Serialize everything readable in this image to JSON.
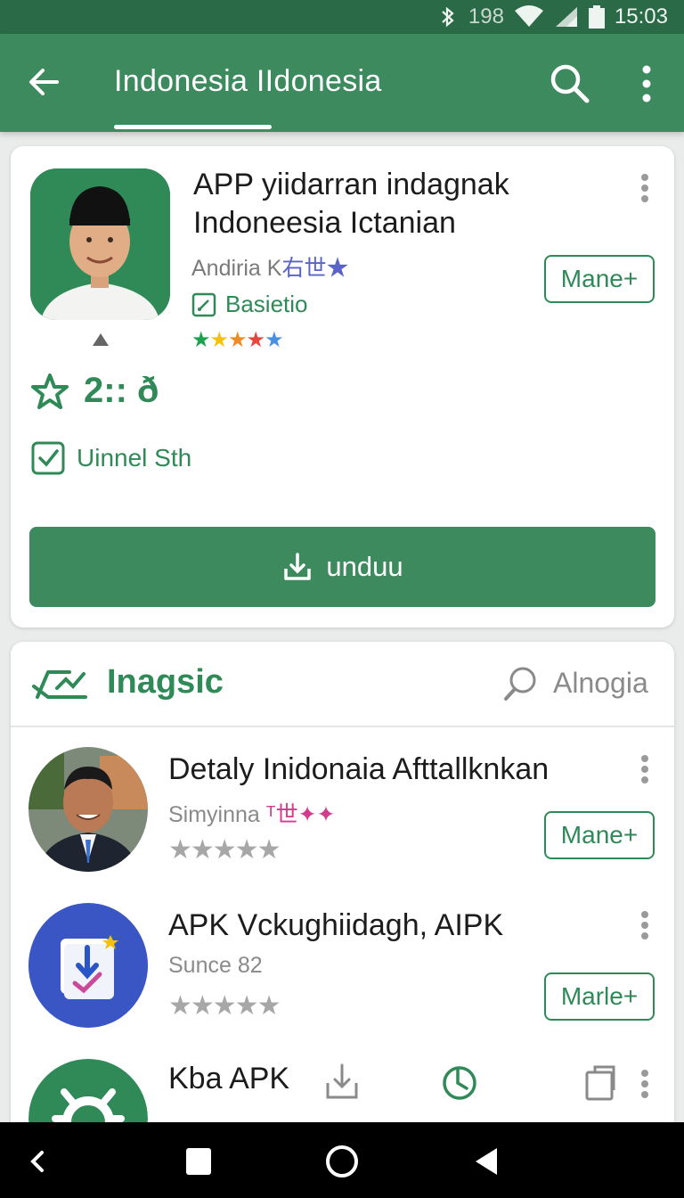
{
  "status_bar": {
    "signal_num": "198",
    "time": "15:03"
  },
  "appbar": {
    "title": "Indonesia IIdonesia"
  },
  "featured": {
    "title_line1": "APP yiidarran indagnak",
    "title_line2": "Indoneesia Ictanian",
    "developer": "Andiria K",
    "developer_accent": "右世★",
    "badge": "Basietio",
    "stars": [
      "★",
      "★",
      "★",
      "★",
      "★"
    ],
    "star_colors": [
      "#1aa34a",
      "#f4c20d",
      "#f08a24",
      "#e8453c",
      "#4a90e2"
    ],
    "rating": "2:: ð",
    "check_label": "Uinnel Sth",
    "install_label": "Mane+",
    "download_label": "unduu"
  },
  "section": {
    "title": "Inagsic",
    "search_label": "Alnogia",
    "items": [
      {
        "name": "Detaly Inidonaia Afttallknkan",
        "sub": "Simyinna",
        "sub_accent": "ᵀ世✦✦",
        "stars": "★★★★★",
        "button": "Mane+"
      },
      {
        "name": "APK Vckughiidagh, AIPK",
        "sub": "Sunce 82",
        "sub_accent": "",
        "stars": "★★★★★",
        "button": "Marle+"
      },
      {
        "name": "Kba APK",
        "sub": "",
        "sub_accent": "",
        "stars": "",
        "button": ""
      }
    ]
  },
  "colors": {
    "primary": "#3d8a5e",
    "primary_dark": "#2b6a47",
    "accent_green": "#2f8a57"
  }
}
